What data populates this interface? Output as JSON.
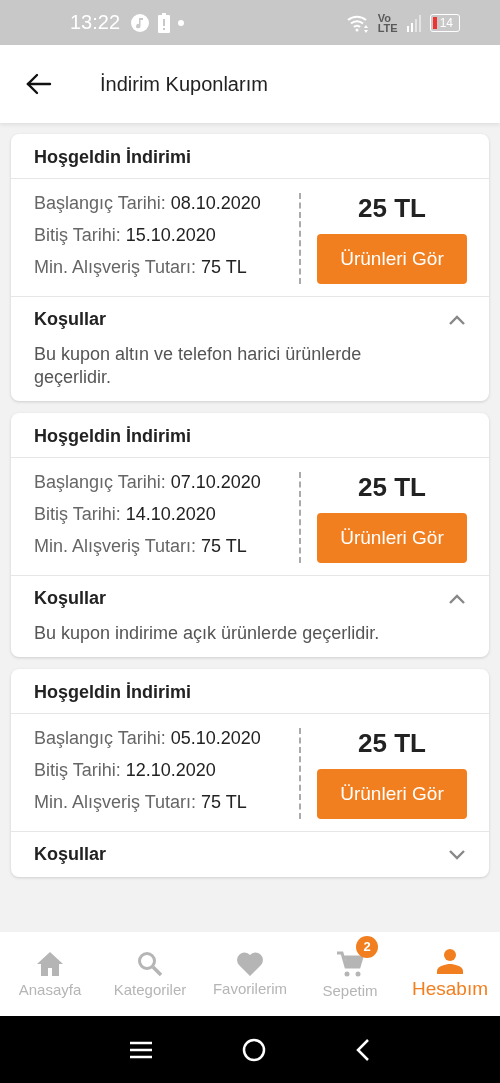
{
  "status_bar": {
    "time": "13:22",
    "network": "Vo\nLTE",
    "battery": "14"
  },
  "header": {
    "title": "İndirim Kuponlarım"
  },
  "coupons": [
    {
      "title": "Hoşgeldin İndirimi",
      "fields": [
        {
          "label": "Başlangıç Tarihi:",
          "value": "08.10.2020"
        },
        {
          "label": "Bitiş Tarihi:",
          "value": "15.10.2020"
        },
        {
          "label": "Min. Alışveriş Tutarı:",
          "value": "75 TL"
        }
      ],
      "amount": "25 TL",
      "button": "Ürünleri Gör",
      "conditions_label": "Koşullar",
      "expanded": true,
      "conditions_text": "Bu kupon altın ve telefon harici ürünlerde geçerlidir."
    },
    {
      "title": "Hoşgeldin İndirimi",
      "fields": [
        {
          "label": "Başlangıç Tarihi:",
          "value": "07.10.2020"
        },
        {
          "label": "Bitiş Tarihi:",
          "value": "14.10.2020"
        },
        {
          "label": "Min. Alışveriş Tutarı:",
          "value": "75 TL"
        }
      ],
      "amount": "25 TL",
      "button": "Ürünleri Gör",
      "conditions_label": "Koşullar",
      "expanded": true,
      "conditions_text": "Bu kupon indirime açık ürünlerde geçerlidir."
    },
    {
      "title": "Hoşgeldin İndirimi",
      "fields": [
        {
          "label": "Başlangıç Tarihi:",
          "value": "05.10.2020"
        },
        {
          "label": "Bitiş Tarihi:",
          "value": "12.10.2020"
        },
        {
          "label": "Min. Alışveriş Tutarı:",
          "value": "75 TL"
        }
      ],
      "amount": "25 TL",
      "button": "Ürünleri Gör",
      "conditions_label": "Koşullar",
      "expanded": false
    }
  ],
  "bottom_nav": [
    {
      "kind": "home",
      "label": "Anasayfa",
      "selected": false
    },
    {
      "kind": "search",
      "label": "Kategoriler",
      "selected": false
    },
    {
      "kind": "heart",
      "label": "Favorilerim",
      "selected": false
    },
    {
      "kind": "cart",
      "label": "Sepetim",
      "selected": false,
      "badge": "2"
    },
    {
      "kind": "person",
      "label": "Hesabım",
      "selected": true
    }
  ]
}
